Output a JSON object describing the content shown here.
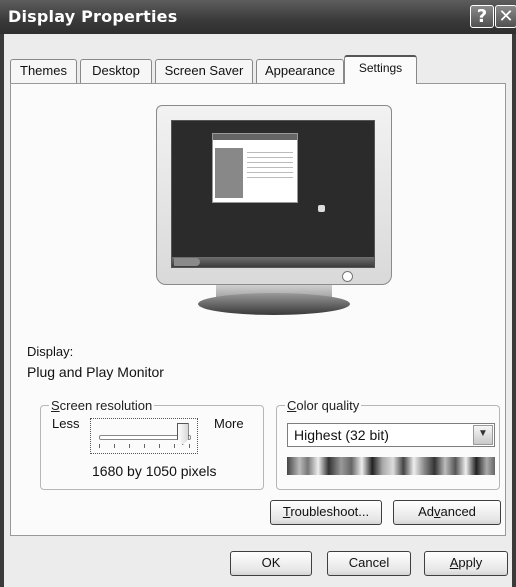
{
  "window": {
    "title": "Display Properties"
  },
  "titlebar": {
    "help_glyph": "?",
    "close_glyph": "✕"
  },
  "tabs": [
    "Themes",
    "Desktop",
    "Screen Saver",
    "Appearance",
    "Settings"
  ],
  "active_tab": "Settings",
  "display": {
    "label": "Display:",
    "value": "Plug and Play Monitor"
  },
  "screen_resolution": {
    "legend_prefix": "",
    "legend_underlined": "S",
    "legend_rest": "creen resolution",
    "less_label": "Less",
    "more_label": "More",
    "slider_fraction": 0.93,
    "value_text": "1680 by 1050 pixels"
  },
  "color_quality": {
    "legend_underlined": "C",
    "legend_rest": "olor quality",
    "selected": "Highest (32 bit)"
  },
  "buttons": {
    "troubleshoot_u": "T",
    "troubleshoot_rest": "roubleshoot...",
    "advanced_pre": "Ad",
    "advanced_u": "v",
    "advanced_rest": "anced",
    "ok": "OK",
    "cancel": "Cancel",
    "apply_u": "A",
    "apply_rest": "pply"
  },
  "icons": {
    "help": "help-icon",
    "close": "close-icon",
    "dropdown": "chevron-down-icon",
    "monitor": "monitor-icon"
  }
}
